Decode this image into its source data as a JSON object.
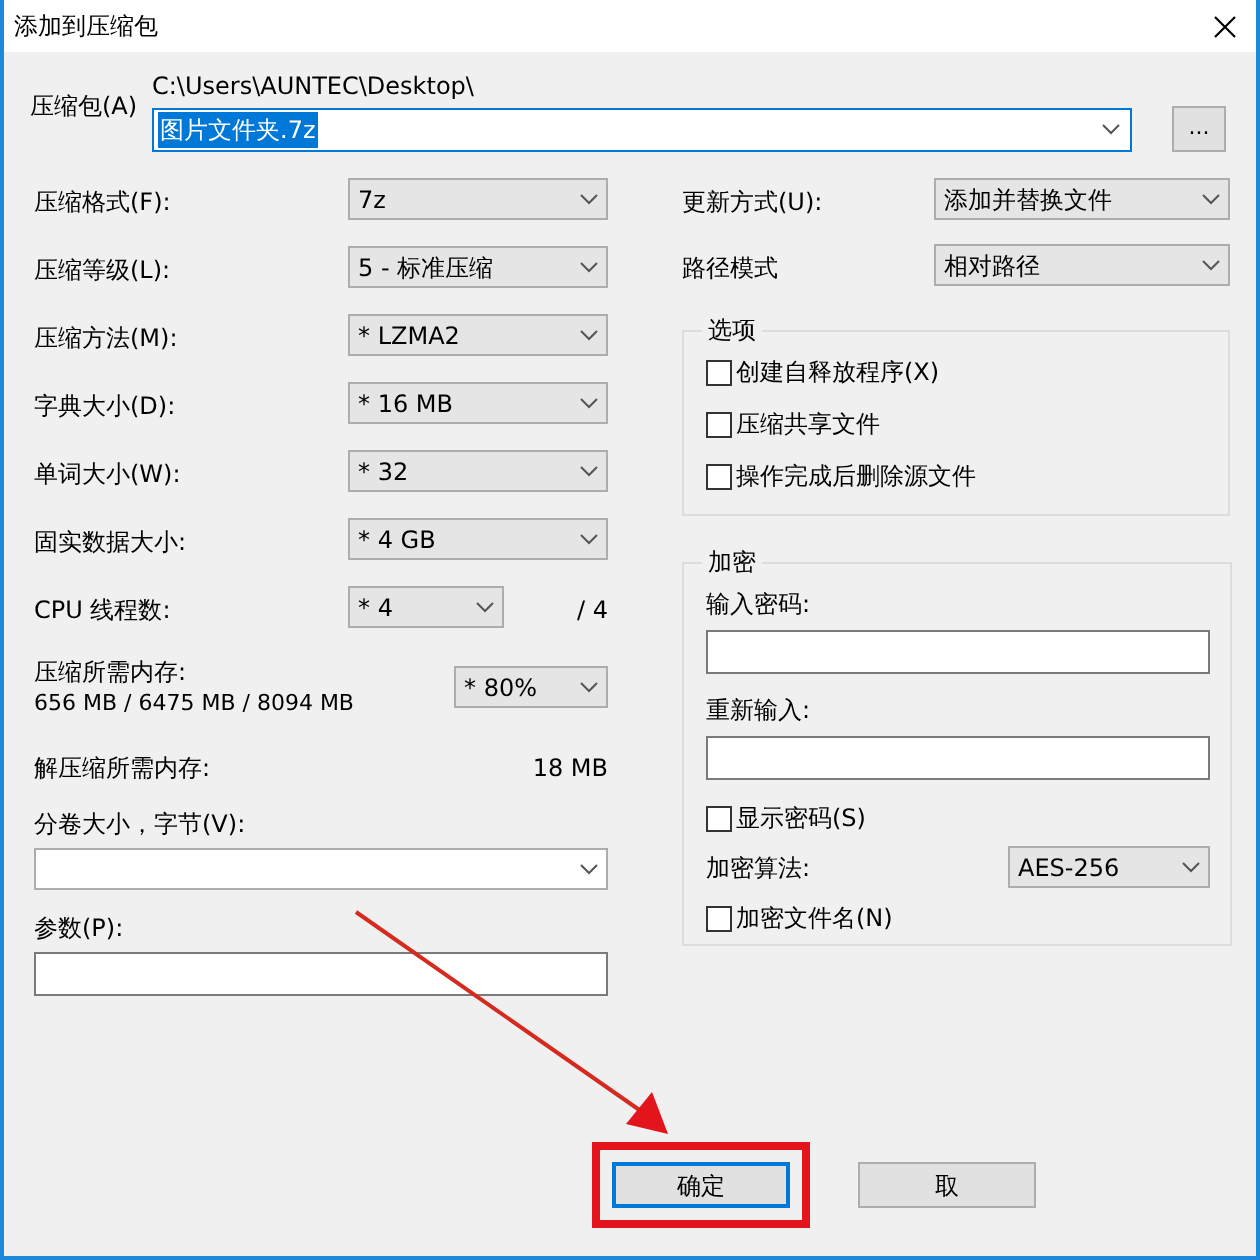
{
  "window": {
    "title": "添加到压缩包"
  },
  "archive": {
    "label": "压缩包(A)",
    "path": "C:\\Users\\AUNTEC\\Desktop\\",
    "value": "图片文件夹.7z",
    "browse": "..."
  },
  "left_settings": [
    {
      "kind": "combo",
      "label": "压缩格式(F):",
      "value": "7z"
    },
    {
      "kind": "combo",
      "label": "压缩等级(L):",
      "value": "5 - 标准压缩"
    },
    {
      "kind": "combo",
      "label": "压缩方法(M):",
      "value": "* LZMA2"
    },
    {
      "kind": "combo",
      "label": "字典大小(D):",
      "value": "* 16 MB"
    },
    {
      "kind": "combo",
      "label": "单词大小(W):",
      "value": "* 32"
    },
    {
      "kind": "combo",
      "label": "固实数据大小:",
      "value": "* 4 GB"
    },
    {
      "kind": "threads",
      "label": "CPU 线程数:",
      "value": "* 4",
      "suffix": "/ 4"
    },
    {
      "kind": "memory",
      "label": "压缩所需内存:",
      "detail": "656 MB / 6475 MB / 8094 MB",
      "value": "* 80%"
    },
    {
      "kind": "reading",
      "label": "解压缩所需内存:",
      "value": "18 MB"
    }
  ],
  "volume": {
    "label": "分卷大小，字节(V):"
  },
  "parameters": {
    "label": "参数(P):"
  },
  "right_settings": [
    {
      "label": "更新方式(U):",
      "value": "添加并替换文件"
    },
    {
      "label": "路径模式",
      "value": "相对路径"
    }
  ],
  "options": {
    "title": "选项",
    "items": [
      {
        "label": "创建自释放程序(X)",
        "checked": false
      },
      {
        "label": "压缩共享文件",
        "checked": false
      },
      {
        "label": "操作完成后删除源文件",
        "checked": false
      }
    ]
  },
  "encryption": {
    "title": "加密",
    "password_label": "输入密码:",
    "reenter_label": "重新输入:",
    "show_password": {
      "label": "显示密码(S)",
      "checked": false
    },
    "method_label": "加密算法:",
    "method": "AES-256",
    "encrypt_names": {
      "label": "加密文件名(N)",
      "checked": false
    }
  },
  "buttons": [
    {
      "label": "确定",
      "highlighted": true
    },
    {
      "label": "取",
      "highlighted": false
    }
  ]
}
